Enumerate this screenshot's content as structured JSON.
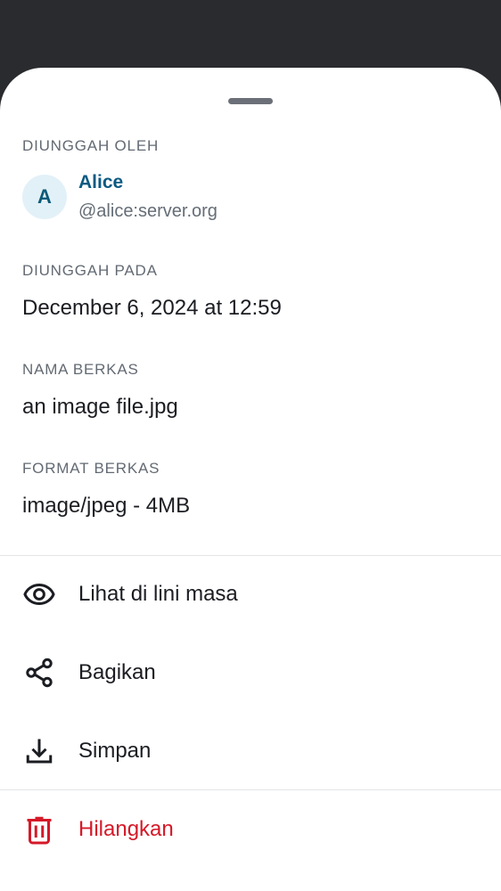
{
  "uploaded_by": {
    "label": "DIUNGGAH OLEH",
    "avatar_initial": "A",
    "name": "Alice",
    "user_id": "@alice:server.org"
  },
  "uploaded_on": {
    "label": "DIUNGGAH PADA",
    "value": "December 6, 2024 at 12:59"
  },
  "file_name": {
    "label": "NAMA BERKAS",
    "value": "an image file.jpg"
  },
  "file_format": {
    "label": "FORMAT BERKAS",
    "value": "image/jpeg - 4MB"
  },
  "actions": [
    {
      "label": "Lihat di lini masa",
      "icon": "eye-icon"
    },
    {
      "label": "Bagikan",
      "icon": "share-icon"
    },
    {
      "label": "Simpan",
      "icon": "download-icon"
    },
    {
      "label": "Hilangkan",
      "icon": "trash-icon",
      "color": "#d51928"
    }
  ],
  "colors": {
    "accent": "#0b5a83",
    "danger": "#d51928",
    "scrim": "#2a2b2e"
  }
}
